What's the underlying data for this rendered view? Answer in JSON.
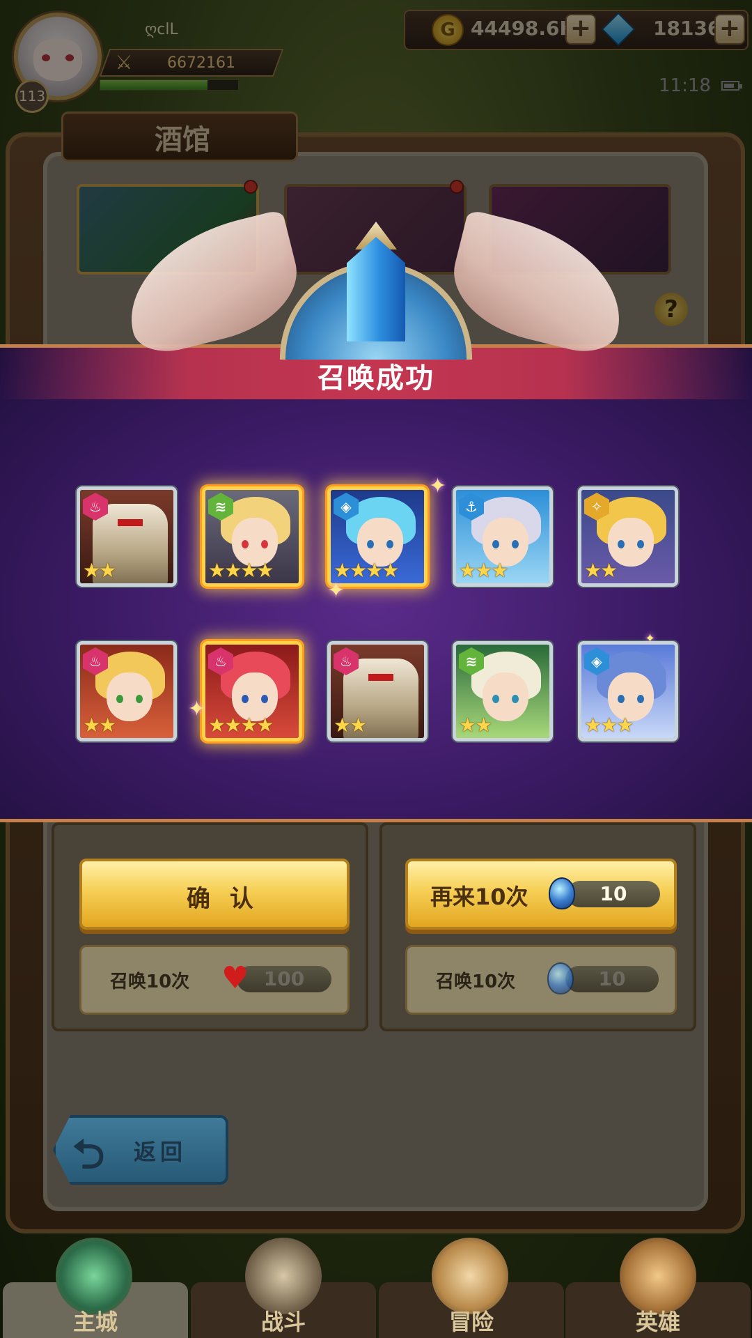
{
  "player": {
    "name": "ღclL",
    "level": "113",
    "power": "6672161",
    "hp_fraction": 0.78
  },
  "resources": {
    "gold": "44498.6K",
    "gems": "18136"
  },
  "status": {
    "time": "11:18"
  },
  "header": {
    "title": "酒馆"
  },
  "help": {
    "label": "?"
  },
  "banner": {
    "title": "召唤成功"
  },
  "heroes": [
    {
      "element": "fire-icon",
      "stars": 2,
      "rare": false
    },
    {
      "element": "wind-icon",
      "stars": 4,
      "rare": true
    },
    {
      "element": "water-icon",
      "stars": 4,
      "rare": true
    },
    {
      "element": "anchor-icon",
      "stars": 3,
      "rare": false
    },
    {
      "element": "light-icon",
      "stars": 2,
      "rare": false
    },
    {
      "element": "fire-icon",
      "stars": 2,
      "rare": false
    },
    {
      "element": "fire-icon",
      "stars": 4,
      "rare": true
    },
    {
      "element": "fire-icon",
      "stars": 2,
      "rare": false
    },
    {
      "element": "wind-icon",
      "stars": 2,
      "rare": false
    },
    {
      "element": "water-icon",
      "stars": 3,
      "rare": false
    }
  ],
  "actions": {
    "confirm_label": "确 认",
    "again_label": "再来10次",
    "again_cost": "10",
    "left_sub_label": "召唤10次",
    "left_sub_cost": "100",
    "right_sub_label": "召唤10次",
    "right_sub_cost": "10",
    "back_label": "返回",
    "back_arrow": "⮌",
    "plus": "+",
    "heart": "♥",
    "star": "★",
    "coin": "G"
  },
  "nav": {
    "items": [
      {
        "label": "主城",
        "active": true
      },
      {
        "label": "战斗",
        "active": false
      },
      {
        "label": "冒险",
        "active": false
      },
      {
        "label": "英雄",
        "active": false
      }
    ]
  },
  "colors": {
    "banner_bg": "#3a1a63",
    "banner_head": "#c43650",
    "gold_button": "#f6cf54",
    "star": "#ffd54a"
  }
}
